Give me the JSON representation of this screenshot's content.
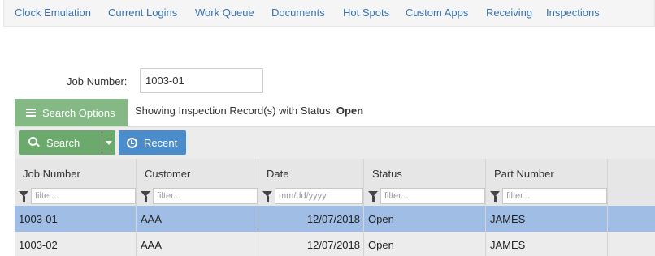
{
  "nav": {
    "items": [
      {
        "label": "Clock Emulation"
      },
      {
        "label": "Current Logins"
      },
      {
        "label": "Work Queue"
      },
      {
        "label": "Documents"
      },
      {
        "label": "Hot Spots"
      },
      {
        "label": "Custom Apps"
      },
      {
        "label": "Receiving"
      },
      {
        "label": "Inspections"
      }
    ]
  },
  "form": {
    "job_label": "Job Number:",
    "job_value": "1003-01"
  },
  "search_options": {
    "label": "Search Options"
  },
  "status_line": {
    "prefix": "Showing Inspection Record(s) with Status:",
    "status": "Open"
  },
  "toolbar": {
    "search_label": "Search",
    "recent_label": "Recent"
  },
  "grid": {
    "columns": [
      "Job Number",
      "Customer",
      "Date",
      "Status",
      "Part Number"
    ],
    "filters": [
      "filter...",
      "filter...",
      "mm/dd/yyyy",
      "filter...",
      "filter..."
    ],
    "rows": [
      {
        "job": "1003-01",
        "customer": "AAA",
        "date": "12/07/2018",
        "status": "Open",
        "part": "JAMES",
        "selected": true
      },
      {
        "job": "1003-02",
        "customer": "AAA",
        "date": "12/07/2018",
        "status": "Open",
        "part": "JAMES",
        "selected": false
      }
    ]
  },
  "colors": {
    "nav_link": "#3a72b0",
    "search_options_bg": "#84b884",
    "search_button_bg": "#6ca96c",
    "recent_button_bg": "#4a8ccc",
    "selected_row_bg": "#a0bde6"
  }
}
